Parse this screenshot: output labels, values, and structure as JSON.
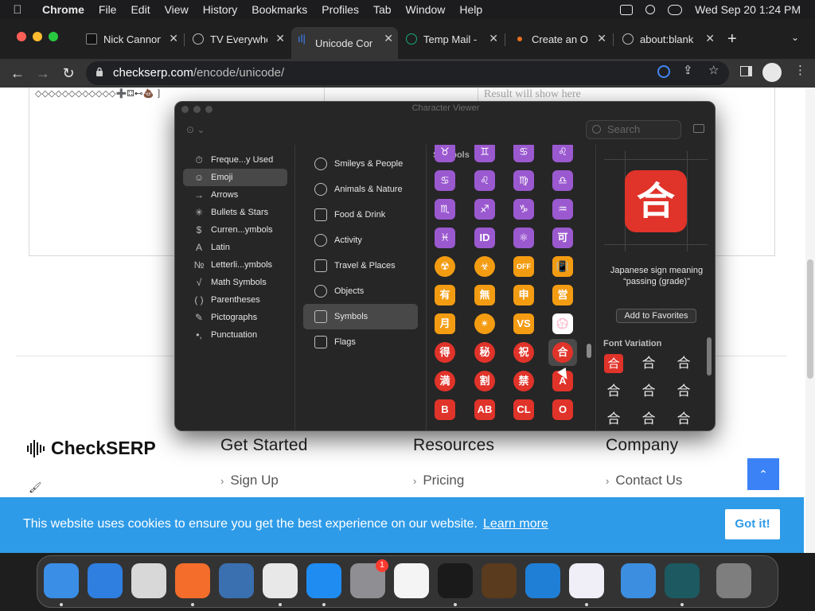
{
  "menubar": {
    "app": "Chrome",
    "items": [
      "File",
      "Edit",
      "View",
      "History",
      "Bookmarks",
      "Profiles",
      "Tab",
      "Window",
      "Help"
    ],
    "clock": "Wed Sep 20  1:24 PM"
  },
  "tabs": [
    {
      "label": "Nick Cannon",
      "favicon_color": "#111111"
    },
    {
      "label": "TV Everywhere",
      "favicon_color": "#8a8a8a"
    },
    {
      "label": "Unicode Con",
      "favicon_color": "#3b82f6",
      "active": true
    },
    {
      "label": "Temp Mail -",
      "favicon_color": "#19a974"
    },
    {
      "label": "Create an O",
      "favicon_color": "#e8711c"
    },
    {
      "label": "about:blank",
      "favicon_color": "#8a8a8a"
    }
  ],
  "omnibox": {
    "host": "checkserp.com",
    "path": "/encode/unicode/"
  },
  "page": {
    "input_snippet": "◇◇◇◇◇◇◇◇◇◇◇◇➕⚃⊷💩 ]",
    "result_placeholder": "Result will show here",
    "brand": "CheckSERP",
    "footer": [
      {
        "heading": "Get Started",
        "link": "Sign Up"
      },
      {
        "heading": "Resources",
        "link": "Pricing"
      },
      {
        "heading": "Company",
        "link": "Contact Us"
      }
    ],
    "cookie_message": "This website uses cookies to ensure you get the best experience on our website.",
    "cookie_learn": "Learn more",
    "cookie_button": "Got it!",
    "to_top_icon": "chevron-up-icon"
  },
  "character_viewer": {
    "title": "Character Viewer",
    "search_placeholder": "Search",
    "categories": [
      {
        "label": "Freque...y Used",
        "icon": "⏱"
      },
      {
        "label": "Emoji",
        "icon": "☺",
        "selected": true
      },
      {
        "label": "Arrows",
        "icon": "→"
      },
      {
        "label": "Bullets & Stars",
        "icon": "✳"
      },
      {
        "label": "Curren...ymbols",
        "icon": "$"
      },
      {
        "label": "Latin",
        "icon": "A"
      },
      {
        "label": "Letterli...ymbols",
        "icon": "№"
      },
      {
        "label": "Math Symbols",
        "icon": "√"
      },
      {
        "label": "Parentheses",
        "icon": "( )"
      },
      {
        "label": "Pictographs",
        "icon": "✎"
      },
      {
        "label": "Punctuation",
        "icon": "•,"
      }
    ],
    "subcategories": [
      {
        "label": "Smileys & People"
      },
      {
        "label": "Animals & Nature"
      },
      {
        "label": "Food & Drink"
      },
      {
        "label": "Activity"
      },
      {
        "label": "Travel & Places"
      },
      {
        "label": "Objects"
      },
      {
        "label": "Symbols",
        "selected": true
      },
      {
        "label": "Flags"
      }
    ],
    "grid_heading": "Symbols",
    "selected_char": "合",
    "char_name": "Japanese sign meaning “passing (grade)”",
    "favorites_button": "Add to Favorites",
    "font_variation_heading": "Font Variation",
    "emoji_rows": [
      [
        "♉",
        "♊",
        "♋",
        "♌"
      ],
      [
        "♋",
        "♌",
        "♍",
        "♎"
      ],
      [
        "♏",
        "♐",
        "♑",
        "♒"
      ],
      [
        "♓",
        "ID",
        "⚛",
        "可"
      ],
      [
        "☢",
        "☣",
        "OFF",
        "📳"
      ],
      [
        "有",
        "無",
        "申",
        "営"
      ],
      [
        "月",
        "✴",
        "VS",
        "💮"
      ],
      [
        "得",
        "秘",
        "祝",
        "合"
      ],
      [
        "満",
        "割",
        "禁",
        "A"
      ],
      [
        "B",
        "AB",
        "CL",
        "O"
      ]
    ],
    "font_variations": [
      "合",
      "合",
      "合",
      "合",
      "合",
      "合",
      "合",
      "合",
      "合"
    ]
  },
  "dock": [
    {
      "name": "finder-icon",
      "color": "#3a8ee6"
    },
    {
      "name": "safari-icon",
      "color": "#2f7fe0"
    },
    {
      "name": "launchpad-icon",
      "color": "#d8d8d8"
    },
    {
      "name": "firefox-icon",
      "color": "#f46d2b"
    },
    {
      "name": "remote-desktop-icon",
      "color": "#3a6fb0"
    },
    {
      "name": "chrome-icon",
      "color": "#e8e8e8"
    },
    {
      "name": "app-store-icon",
      "color": "#1f8cf2"
    },
    {
      "name": "system-settings-icon",
      "color": "#8e8e93",
      "badge": "1"
    },
    {
      "name": "textedit-icon",
      "color": "#f4f4f4"
    },
    {
      "name": "terminal-icon",
      "color": "#1a1a1a"
    },
    {
      "name": "garageband-icon",
      "color": "#5a3b1e"
    },
    {
      "name": "vscode-icon",
      "color": "#1f7fd6"
    },
    {
      "name": "visual-studio-icon",
      "color": "#f0eef6"
    },
    {
      "name": "weather-icon",
      "color": "#3c8ee0"
    },
    {
      "name": "vscode-insiders-icon",
      "color": "#1c5960"
    },
    {
      "name": "trash-icon",
      "color": "#7e7e7e"
    }
  ]
}
